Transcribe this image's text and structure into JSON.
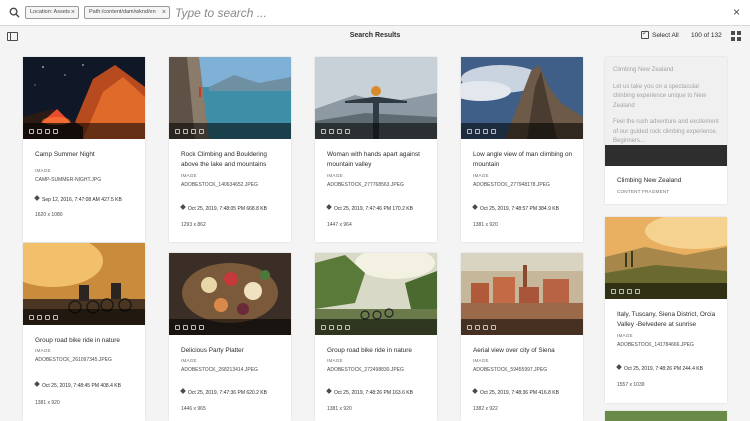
{
  "search": {
    "tags": [
      {
        "label": "Location: Assets",
        "close": "×"
      },
      {
        "label": "Path:/content/dam/wknd/en",
        "close": "×"
      }
    ],
    "placeholder": "Type to search ...",
    "close": "×"
  },
  "actionbar": {
    "title": "Search Results",
    "select_all": "Select All",
    "count": "100 of 132"
  },
  "colors": {
    "background": "#f4f4f4",
    "card": "#ffffff",
    "quick_actions_bar": "#2e2e2e"
  },
  "cards": [
    {
      "title": "Camp Summer Night",
      "type": "IMAGE",
      "file": "CAMP-SUMMER-NIGHT.JPG",
      "meta": "Sep 12, 2016, 7:47:08 AM   427.5 KB",
      "dims": "1620 x 1080"
    },
    {
      "title": "Rock Climbing and Bouldering above the lake and mountains",
      "type": "IMAGE",
      "file": "ADOBESTOCK_140634652.JPEG",
      "meta": "Oct 25, 2019, 7:48:05 PM   668.8 KB",
      "dims": "1293 x 862"
    },
    {
      "title": "Woman with hands apart against mountain valley",
      "type": "IMAGE",
      "file": "ADOBESTOCK_277768563.JPEG",
      "meta": "Oct 25, 2019, 7:47:46 PM   170.2 KB",
      "dims": "1447 x 964"
    },
    {
      "title": "Low angle view of man climbing on mountain",
      "type": "IMAGE",
      "file": "ADOBESTOCK_277948178.JPEG",
      "meta": "Oct 25, 2019, 7:48:57 PM   384.9 KB",
      "dims": "1381 x 920"
    },
    {
      "title": "Group road bike ride in nature",
      "type": "IMAGE",
      "file": "ADOBESTOCK_261097345.JPEG",
      "meta": "Oct 25, 2019, 7:48:45 PM   408.4 KB",
      "dims": "1381 x 920"
    },
    {
      "title": "Delicious Party Platter",
      "type": "IMAGE",
      "file": "ADOBESTOCK_268213414.JPEG",
      "meta": "Oct 25, 2019, 7:47:36 PM   620.2 KB",
      "dims": "1446 x 965"
    },
    {
      "title": "Group road bike ride in nature",
      "type": "IMAGE",
      "file": "ADOBESTOCK_272498830.JPEG",
      "meta": "Oct 25, 2019, 7:48:26 PM   163.6 KB",
      "dims": "1381 x 920"
    },
    {
      "title": "Aerial view over city of Siena",
      "type": "IMAGE",
      "file": "ADOBESTOCK_59455997.JPEG",
      "meta": "Oct 25, 2019, 7:48:36 PM   416.8 KB",
      "dims": "1382 x 922"
    },
    {
      "title": "Italy, Tuscany, Siena District, Orcia Valley -Belvedere at sunrise",
      "type": "IMAGE",
      "file": "ADOBESTOCK_141784666.JPEG",
      "meta": "Oct 25, 2019, 7:48:26 PM   244.4 KB",
      "dims": "1557 x 1039"
    }
  ],
  "fragment": {
    "lines": [
      "Climbing New Zealand",
      "Let us take you on a spectacular climbing experience unique to New Zealand",
      "Feel the rush adventure and excitement of our guided rock climbing experience. Beginners..."
    ],
    "title": "Climbing New Zealand",
    "type": "CONTENT FRAGMENT"
  }
}
